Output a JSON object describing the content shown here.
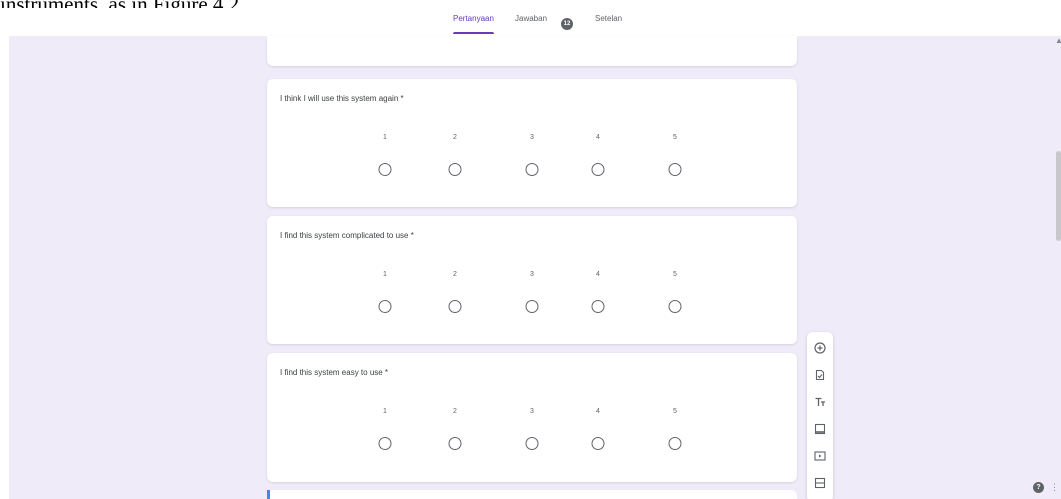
{
  "document": {
    "caption": "instruments, as in Figure 4.2."
  },
  "tabs": [
    {
      "label": "Pertanyaan",
      "active": true
    },
    {
      "label": "Jawaban",
      "active": false
    },
    {
      "label": "Setelan",
      "active": false
    }
  ],
  "response_count": "12",
  "questions": [
    {
      "text": "I think I will use this system again *",
      "scale": [
        "1",
        "2",
        "3",
        "4",
        "5"
      ]
    },
    {
      "text": "I find this system complicated to use *",
      "scale": [
        "1",
        "2",
        "3",
        "4",
        "5"
      ]
    },
    {
      "text": "I find this system easy to use *",
      "scale": [
        "1",
        "2",
        "3",
        "4",
        "5"
      ]
    }
  ],
  "toolbar": [
    "add-question-icon",
    "import-questions-icon",
    "add-title-icon",
    "add-image-icon",
    "add-video-icon",
    "add-section-icon"
  ],
  "help": {
    "label": "?",
    "more": "⋮"
  },
  "scroll": {
    "arrow": "▲"
  },
  "colors": {
    "accent": "#673ab7",
    "background": "#efebf8",
    "card": "#ffffff",
    "section_accent": "#4285f4"
  }
}
